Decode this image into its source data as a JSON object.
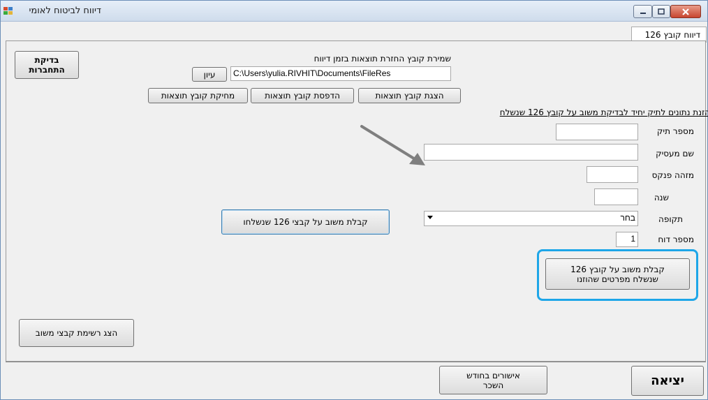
{
  "window": {
    "title": "דיווח לביטוח לאומי",
    "tab_label": "דיווח קובץ 126"
  },
  "top": {
    "check_connection_label": "בדיקת התחברות",
    "save_caption": "שמירת קובץ החזרת תוצאות בזמן דיווח",
    "save_path": "C:\\Users\\yulia.RIVHIT\\Documents\\FileRes",
    "browse_label": "עיון",
    "show_results_label": "הצגת קובץ תוצאות",
    "print_results_label": "הדפסת קובץ תוצאות",
    "delete_results_label": "מחיקת קובץ תוצאות"
  },
  "form": {
    "section_title": "הזנת נתונים לתיק יחיד לבדיקת משוב על קובץ 126 שנשלח",
    "file_number_label": "מספר תיק",
    "file_number_value": "",
    "employer_name_label": "שם מעסיק",
    "employer_name_value": "",
    "ledger_id_label": "מזהה פנקס",
    "ledger_id_value": "",
    "year_label": "שנה",
    "year_value": "",
    "period_label": "תקופה",
    "period_value": "בחר",
    "report_number_label": "מספר דוח",
    "report_number_value": "1",
    "get_feedback_sent_label": "קבלת משוב על קבצי 126 שנשלחו",
    "get_feedback_details_line1": "קבלת משוב על קובץ 126",
    "get_feedback_details_line2": "שנשלח מפרטים שהוזנו",
    "show_feedback_list_label": "הצג רשימת קבצי משוב"
  },
  "bottom": {
    "approvals_line1": "אישורים בחודש",
    "approvals_line2": "השכר",
    "exit_label": "יציאה"
  },
  "colors": {
    "highlight": "#1ea6e8",
    "arrow": "#7f7f7f"
  }
}
